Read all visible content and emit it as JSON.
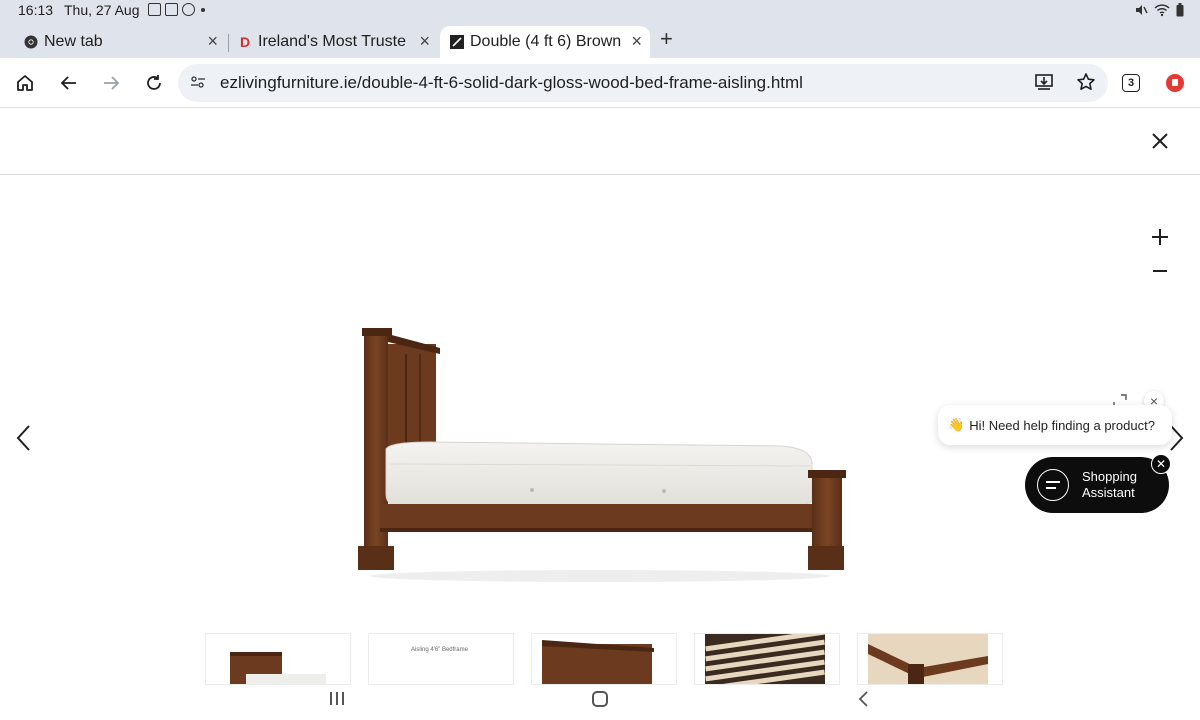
{
  "status_bar": {
    "time": "16:13",
    "date": "Thu, 27 Aug",
    "left_icons": [
      "image-icon",
      "calendar-icon",
      "alert-icon"
    ],
    "right_icons": [
      "mute-icon",
      "wifi-icon",
      "battery-icon"
    ]
  },
  "tabs": [
    {
      "title": "New tab",
      "favicon": "chrome-icon",
      "active": false
    },
    {
      "title": "Ireland's Most Truste",
      "favicon": "D",
      "favicon_color": "#d32f2f",
      "active": false
    },
    {
      "title": "Double (4 ft 6) Brown",
      "favicon": "ez-icon",
      "active": true
    }
  ],
  "toolbar": {
    "url": "ezlivingfurniture.ie/double-4-ft-6-solid-dark-gloss-wood-bed-frame-aisling.html",
    "tab_count": "3"
  },
  "gallery": {
    "close_icon": "close-icon",
    "zoom_in_icon": "plus-icon",
    "zoom_out_icon": "minus-icon",
    "prev_icon": "chevron-left-icon",
    "next_icon": "chevron-right-icon",
    "thumbnails": [
      {
        "name": "thumbnail-bed-front",
        "caption": ""
      },
      {
        "name": "thumbnail-dimensions",
        "caption": "Aisling 4'6\" Bedframe"
      },
      {
        "name": "thumbnail-headboard-detail",
        "caption": ""
      },
      {
        "name": "thumbnail-slats",
        "caption": ""
      },
      {
        "name": "thumbnail-corner-detail",
        "caption": ""
      }
    ]
  },
  "chat": {
    "greeting": "Hi! Need help finding a product?",
    "button_label": "Shopping Assistant"
  },
  "colors": {
    "wood": "#6b3a1f",
    "wood_dark": "#4a2613",
    "chrome_bg": "#dfe3eb",
    "omnibox_bg": "#eef1f6",
    "assistant_bg": "#0d0d0d"
  }
}
